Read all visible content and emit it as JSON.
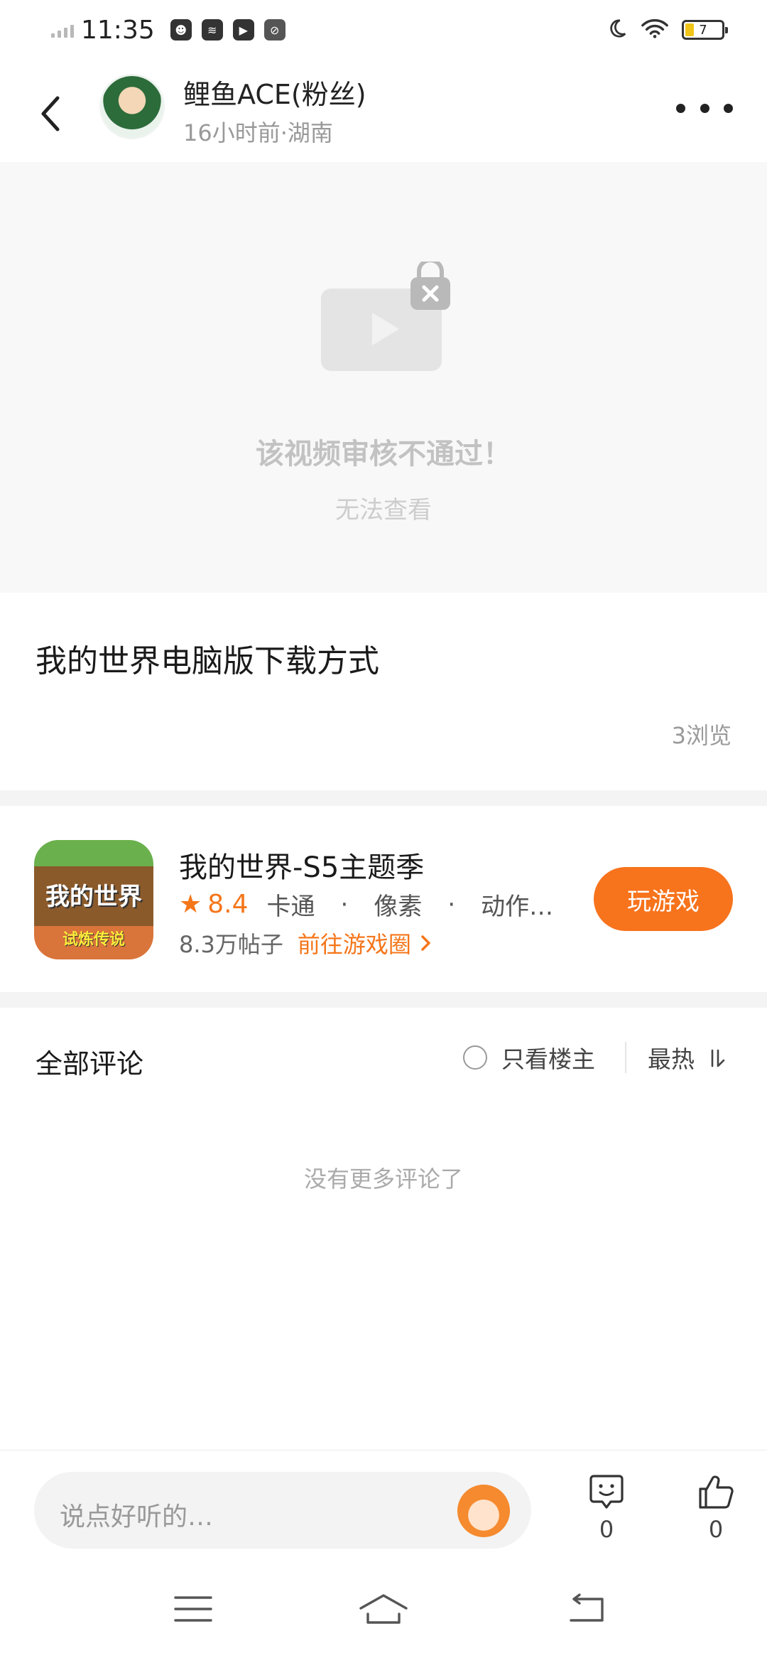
{
  "status_bar": {
    "time": "11:35",
    "battery": "7",
    "icons": [
      "signal-icon",
      "app-icon-1",
      "app-icon-2",
      "play-app-icon",
      "app-icon-4",
      "moon-icon",
      "wifi-icon",
      "battery-icon"
    ]
  },
  "header": {
    "author_name": "鲤鱼ACE(粉丝)",
    "author_meta": "16小时前·湖南"
  },
  "video": {
    "title": "该视频审核不通过！",
    "subtitle": "无法查看"
  },
  "post": {
    "title": "我的世界电脑版下载方式",
    "views": "3浏览"
  },
  "game": {
    "icon_title": "我的世界",
    "icon_subtitle": "试炼传说",
    "name": "我的世界-S5主题季",
    "score": "8.4",
    "tags": [
      "卡通",
      "像素",
      "动作…"
    ],
    "posts": "8.3万帖子",
    "circle_link": "前往游戏圈",
    "play_label": "玩游戏"
  },
  "comments": {
    "title": "全部评论",
    "only_author": "只看楼主",
    "sort": "最热",
    "empty": "没有更多评论了"
  },
  "bottom_bar": {
    "placeholder": "说点好听的…",
    "comment_count": "0",
    "like_count": "0"
  },
  "colors": {
    "accent": "#f7731c",
    "rating": "#f5761a",
    "divider": "#f4f4f4"
  }
}
